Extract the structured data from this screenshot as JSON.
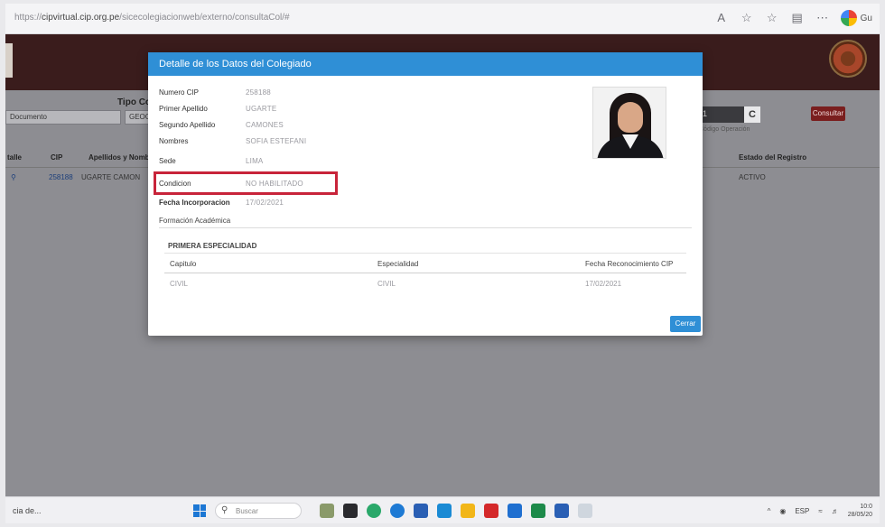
{
  "browser": {
    "url_prefix": "https://",
    "url_host": "cipvirtual.cip.org.pe",
    "url_path": "/sicecolegiacionweb/externo/consultaCol/#",
    "icons": [
      "read-aloud-icon",
      "favorite-icon",
      "collections-icon",
      "extensions-icon",
      "more-icon",
      "profile-icon"
    ],
    "profile_label": "Gu"
  },
  "page": {
    "tipo_label": "Tipo Co",
    "doc_select_value": "Documento",
    "doc_select2_value": "GEOGR",
    "captcha_value": "1",
    "captcha_refresh": "C",
    "captcha_hint": "Código Operación",
    "consultar_label": "Consultar",
    "table": {
      "headers": [
        "talle",
        "CIP",
        "Apellidos y Nomb",
        "Estado del Registro"
      ],
      "row": {
        "detail_icon": "search-icon",
        "cip": "258188",
        "name": "UGARTE CAMON",
        "estado": "ACTIVO"
      }
    }
  },
  "modal": {
    "title": "Detalle de los Datos del Colegiado",
    "fields": [
      {
        "label": "Numero CIP",
        "value": "258188"
      },
      {
        "label": "Primer Apellido",
        "value": "UGARTE"
      },
      {
        "label": "Segundo Apellido",
        "value": "CAMONES"
      },
      {
        "label": "Nombres",
        "value": "SOFIA ESTEFANI"
      },
      {
        "label": "Sede",
        "value": "LIMA"
      },
      {
        "label": "Condicion",
        "value": "NO HABILITADO"
      },
      {
        "label": "Fecha Incorporacion",
        "value": "17/02/2021"
      }
    ],
    "section_title": "Formación Académica",
    "specialty": {
      "title": "PRIMERA ESPECIALIDAD",
      "headers": [
        "Capitulo",
        "Especialidad",
        "Fecha Reconocimiento CIP"
      ],
      "values": [
        "CIVIL",
        "CIVIL",
        "17/02/2021"
      ]
    },
    "close_label": "Cerrar"
  },
  "taskbar": {
    "left_text": "cia de...",
    "search_placeholder": "Buscar",
    "tray_lang": "ESP",
    "time": "10:0",
    "date": "28/05/20"
  },
  "colors": {
    "modal_header": "#2f8fd6",
    "highlight": "#c8243a",
    "app_header": "#3a1c1c",
    "consultar_button": "#7a1e1e"
  }
}
